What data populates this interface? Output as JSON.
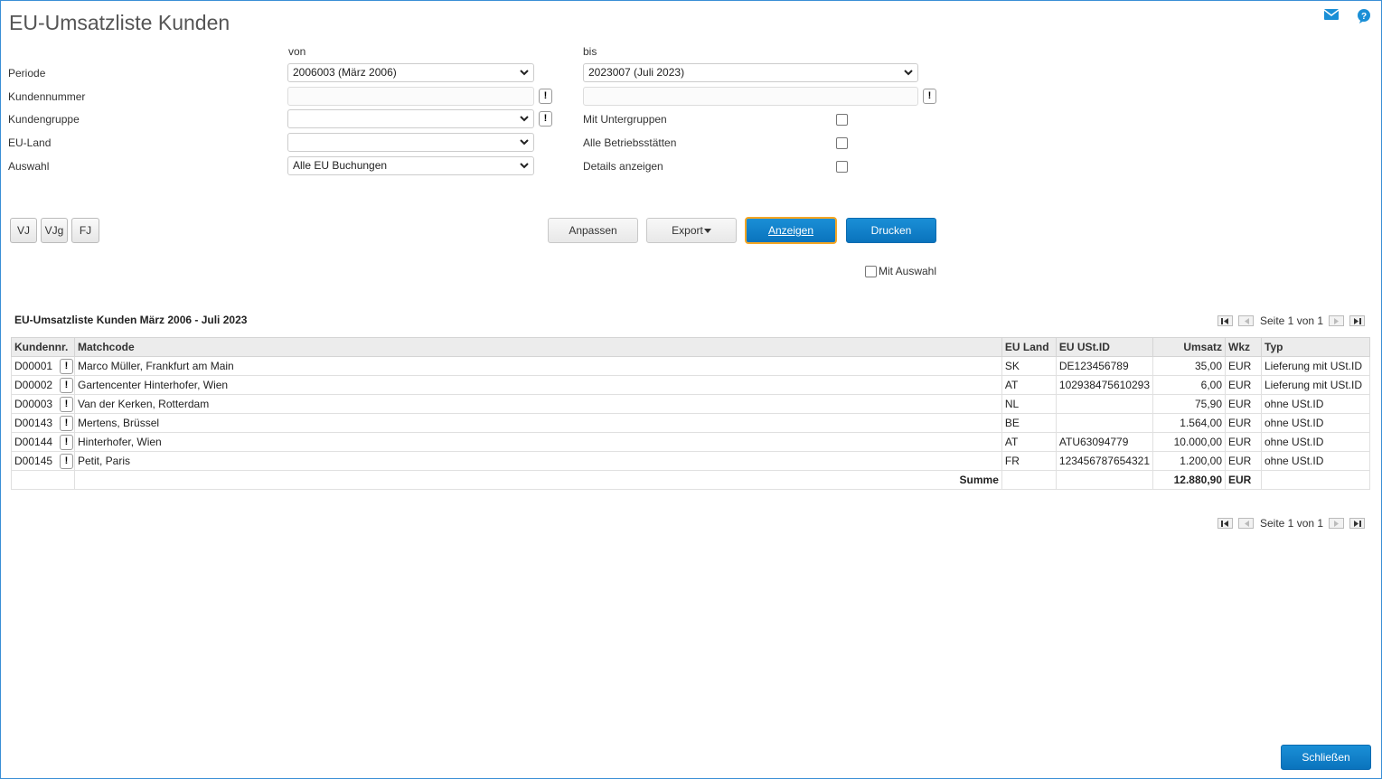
{
  "page": {
    "title": "EU-Umsatzliste Kunden"
  },
  "icons": {
    "mail": "mail-icon",
    "help": "help-icon"
  },
  "filters": {
    "von_label": "von",
    "bis_label": "bis",
    "periode_label": "Periode",
    "periode_von": "2006003 (März 2006)",
    "periode_bis": "2023007 (Juli 2023)",
    "kundennummer_label": "Kundennummer",
    "kundengruppe_label": "Kundengruppe",
    "euland_label": "EU-Land",
    "auswahl_label": "Auswahl",
    "auswahl_value": "Alle EU Buchungen",
    "mit_untergruppen_label": "Mit Untergruppen",
    "alle_betriebsstaetten_label": "Alle Betriebsstätten",
    "details_anzeigen_label": "Details anzeigen",
    "exclamation": "!"
  },
  "buttons": {
    "vj": "VJ",
    "vjg": "VJg",
    "fj": "FJ",
    "anpassen": "Anpassen",
    "export": "Export",
    "anzeigen": "Anzeigen",
    "drucken": "Drucken",
    "mit_auswahl": "Mit Auswahl",
    "schliessen": "Schließen"
  },
  "table": {
    "title": "EU-Umsatzliste Kunden März 2006 - Juli 2023",
    "pager_text": "Seite 1 von 1",
    "columns": [
      "Kundennr.",
      "Matchcode",
      "EU Land",
      "EU USt.ID",
      "Umsatz",
      "Wkz",
      "Typ"
    ],
    "rows": [
      {
        "nr": "D00001",
        "matchcode": "Marco Müller, Frankfurt am Main",
        "land": "SK",
        "ustid": "DE123456789",
        "umsatz": "35,00",
        "wkz": "EUR",
        "typ": "Lieferung mit USt.ID"
      },
      {
        "nr": "D00002",
        "matchcode": "Gartencenter Hinterhofer, Wien",
        "land": "AT",
        "ustid": "102938475610293",
        "umsatz": "6,00",
        "wkz": "EUR",
        "typ": "Lieferung mit USt.ID"
      },
      {
        "nr": "D00003",
        "matchcode": "Van der Kerken, Rotterdam",
        "land": "NL",
        "ustid": "",
        "umsatz": "75,90",
        "wkz": "EUR",
        "typ": "ohne USt.ID"
      },
      {
        "nr": "D00143",
        "matchcode": "Mertens, Brüssel",
        "land": "BE",
        "ustid": "",
        "umsatz": "1.564,00",
        "wkz": "EUR",
        "typ": "ohne USt.ID"
      },
      {
        "nr": "D00144",
        "matchcode": "Hinterhofer, Wien",
        "land": "AT",
        "ustid": "ATU63094779",
        "umsatz": "10.000,00",
        "wkz": "EUR",
        "typ": "ohne USt.ID"
      },
      {
        "nr": "D00145",
        "matchcode": "Petit, Paris",
        "land": "FR",
        "ustid": "123456787654321",
        "umsatz": "1.200,00",
        "wkz": "EUR",
        "typ": "ohne USt.ID"
      }
    ],
    "sum_label": "Summe",
    "sum_value": "12.880,90",
    "sum_wkz": "EUR"
  }
}
